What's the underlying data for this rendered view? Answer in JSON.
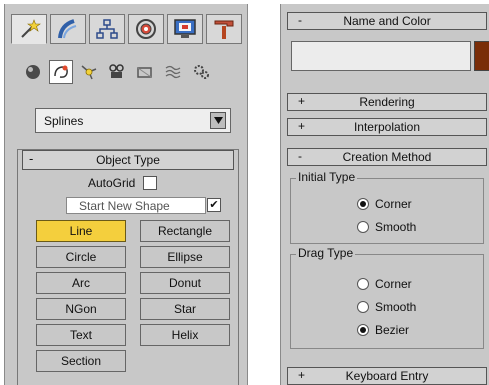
{
  "left_panel": {
    "tabs": [
      {
        "icon": "create-wand-icon",
        "active": true
      },
      {
        "icon": "modify-bend-icon",
        "active": false
      },
      {
        "icon": "hierarchy-icon",
        "active": false
      },
      {
        "icon": "motion-wheel-icon",
        "active": false
      },
      {
        "icon": "display-monitor-icon",
        "active": false
      },
      {
        "icon": "utilities-hammer-icon",
        "active": false
      }
    ],
    "subcategories": [
      {
        "icon": "geometry-sphere-icon",
        "active": false
      },
      {
        "icon": "shapes-icon",
        "active": true
      },
      {
        "icon": "lights-icon",
        "active": false
      },
      {
        "icon": "cameras-icon",
        "active": false
      },
      {
        "icon": "helpers-icon",
        "active": false
      },
      {
        "icon": "spacewarps-icon",
        "active": false
      },
      {
        "icon": "systems-icon",
        "active": false
      }
    ],
    "category_dropdown": {
      "value": "Splines"
    },
    "object_type": {
      "title": "Object Type",
      "collapse_sign": "-",
      "autogrid_label": "AutoGrid",
      "autogrid_checked": false,
      "start_new_shape_label": "Start New Shape",
      "start_new_shape_checked": true,
      "checkmark": "✔",
      "buttons": [
        {
          "label": "Line",
          "active": true
        },
        {
          "label": "Rectangle",
          "active": false
        },
        {
          "label": "Circle",
          "active": false
        },
        {
          "label": "Ellipse",
          "active": false
        },
        {
          "label": "Arc",
          "active": false
        },
        {
          "label": "Donut",
          "active": false
        },
        {
          "label": "NGon",
          "active": false
        },
        {
          "label": "Star",
          "active": false
        },
        {
          "label": "Text",
          "active": false
        },
        {
          "label": "Helix",
          "active": false
        },
        {
          "label": "Section",
          "active": false
        }
      ]
    }
  },
  "right_panel": {
    "name_and_color": {
      "title": "Name and Color",
      "sign": "-",
      "name_value": "",
      "color": "#7a2d08"
    },
    "rendering": {
      "title": "Rendering",
      "sign": "+"
    },
    "interpolation": {
      "title": "Interpolation",
      "sign": "+"
    },
    "creation_method": {
      "title": "Creation Method",
      "sign": "-",
      "initial_type": {
        "label": "Initial Type",
        "options": [
          {
            "label": "Corner",
            "selected": true
          },
          {
            "label": "Smooth",
            "selected": false
          }
        ]
      },
      "drag_type": {
        "label": "Drag Type",
        "options": [
          {
            "label": "Corner",
            "selected": false
          },
          {
            "label": "Smooth",
            "selected": false
          },
          {
            "label": "Bezier",
            "selected": true
          }
        ]
      }
    },
    "keyboard_entry": {
      "title": "Keyboard Entry",
      "sign": "+"
    }
  },
  "colors": {
    "active_button": "#f4cf3d",
    "panel": "#c8c8c8",
    "swatch": "#7a2d08"
  }
}
